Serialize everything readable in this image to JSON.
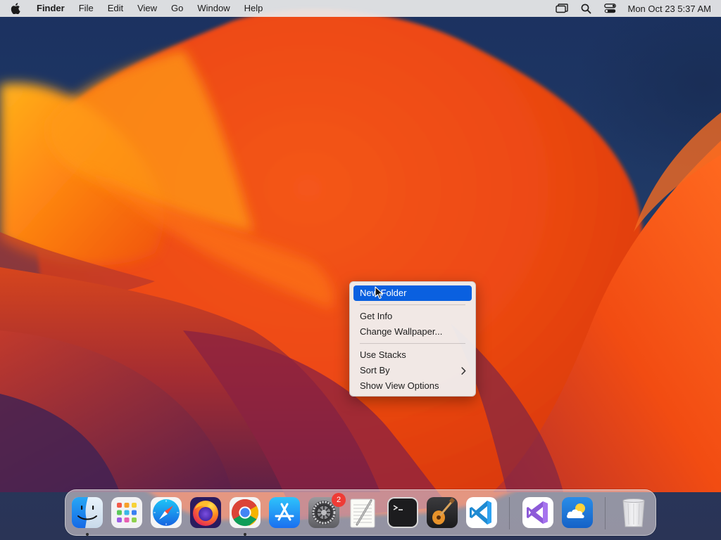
{
  "menubar": {
    "app_name": "Finder",
    "menus": [
      "File",
      "Edit",
      "View",
      "Go",
      "Window",
      "Help"
    ],
    "clock": "Mon Oct 23  5:37 AM"
  },
  "context_menu": {
    "groups": [
      {
        "items": [
          {
            "label": "New Folder",
            "highlighted": true
          }
        ]
      },
      {
        "items": [
          {
            "label": "Get Info"
          },
          {
            "label": "Change Wallpaper..."
          }
        ]
      },
      {
        "items": [
          {
            "label": "Use Stacks"
          },
          {
            "label": "Sort By",
            "submenu": true
          },
          {
            "label": "Show View Options"
          }
        ]
      }
    ]
  },
  "dock": {
    "apps": [
      {
        "name": "Finder",
        "icon": "finder-icon",
        "running": true
      },
      {
        "name": "Launchpad",
        "icon": "launchpad-icon"
      },
      {
        "name": "Safari",
        "icon": "safari-icon"
      },
      {
        "name": "Firefox",
        "icon": "firefox-icon"
      },
      {
        "name": "Google Chrome",
        "icon": "chrome-icon",
        "running": true
      },
      {
        "name": "App Store",
        "icon": "app-store-icon"
      },
      {
        "name": "System Settings",
        "icon": "system-settings-icon",
        "badge": "2"
      },
      {
        "name": "TextEdit",
        "icon": "textedit-icon"
      },
      {
        "name": "Terminal",
        "icon": "terminal-icon"
      },
      {
        "name": "GarageBand",
        "icon": "garageband-icon"
      },
      {
        "name": "Visual Studio Code",
        "icon": "vscode-icon"
      },
      {
        "name": "Visual Studio",
        "icon": "visual-studio-icon"
      },
      {
        "name": "Weather",
        "icon": "weather-icon"
      },
      {
        "name": "Trash",
        "icon": "trash-icon"
      }
    ]
  },
  "colors": {
    "menu_highlight": "#0a60e0",
    "badge": "#ef3b35"
  }
}
